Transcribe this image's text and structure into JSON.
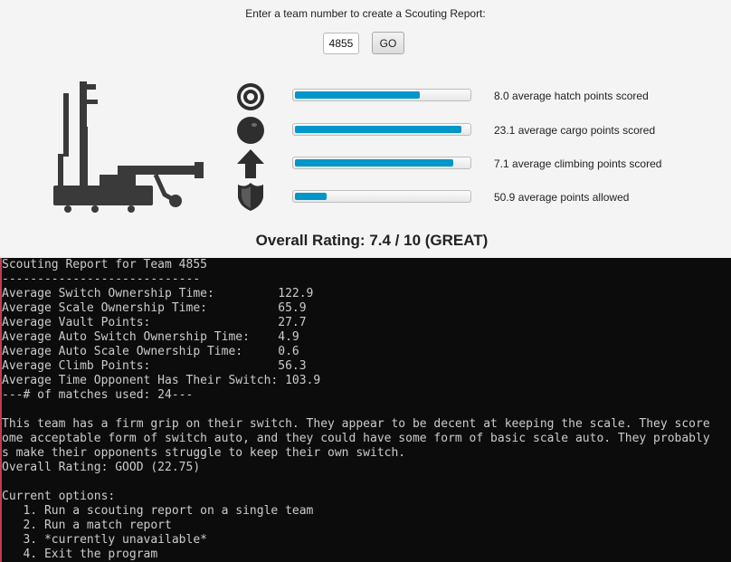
{
  "gui": {
    "prompt": "Enter a team number to create a Scouting Report:",
    "team_input_value": "4855",
    "go_label": "GO",
    "stats": [
      {
        "icon": "hatch-panel-icon",
        "fill": 0.71,
        "label": "8.0 average hatch points scored"
      },
      {
        "icon": "cargo-ball-icon",
        "fill": 0.95,
        "label": "23.1 average cargo points scored"
      },
      {
        "icon": "climb-arrow-icon",
        "fill": 0.9,
        "label": "7.1 average climbing points scored"
      },
      {
        "icon": "shield-icon",
        "fill": 0.18,
        "label": "50.9 average points allowed"
      }
    ],
    "overall_rating": "Overall Rating: 7.4 / 10 (GREAT)",
    "accent_color": "#0096c9"
  },
  "console": {
    "lines": [
      "Scouting Report for Team 4855",
      "----------------------------",
      "Average Switch Ownership Time:         122.9",
      "Average Scale Ownership Time:          65.9",
      "Average Vault Points:                  27.7",
      "Average Auto Switch Ownership Time:    4.9",
      "Average Auto Scale Ownership Time:     0.6",
      "Average Climb Points:                  56.3",
      "Average Time Opponent Has Their Switch: 103.9",
      "---# of matches used: 24---",
      "",
      "This team has a firm grip on their switch. They appear to be decent at keeping the scale. They score",
      "ome acceptable form of switch auto, and they could have some form of basic scale auto. They probably",
      "s make their opponents struggle to keep their own switch.",
      "Overall Rating: GOOD (22.75)",
      "",
      "Current options:",
      "   1. Run a scouting report on a single team",
      "   2. Run a match report",
      "   3. *currently unavailable*",
      "   4. Exit the program"
    ]
  }
}
